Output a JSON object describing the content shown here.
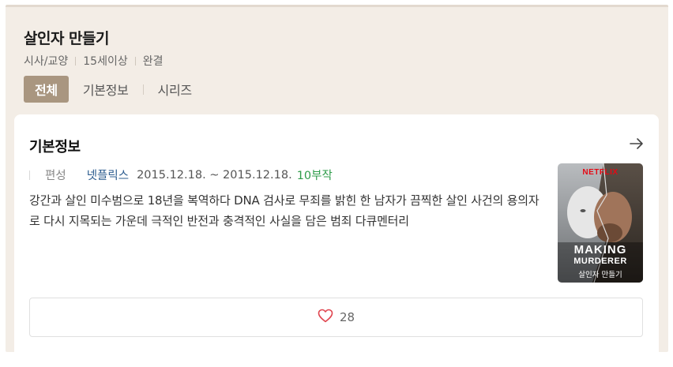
{
  "program": {
    "title": "살인자 만들기",
    "meta": [
      "시사/교양",
      "15세이상",
      "완결"
    ]
  },
  "tabs": [
    "전체",
    "기본정보",
    "시리즈"
  ],
  "info_card": {
    "title": "기본정보",
    "broadcast_label": "편성",
    "channel": "넷플릭스",
    "dates": "2015.12.18. ~ 2015.12.18.",
    "episodes": "10부작",
    "description": "강간과 살인 미수범으로 18년을 복역하다 DNA 검사로 무죄를 밝힌 한 남자가 끔찍한 살인 사건의 용의자로 다시 지목되는 가운데 극적인 반전과 충격적인 사실을 담은 범죄 다큐멘터리",
    "poster": {
      "brand": "NETFLIX",
      "line1": "MAKING",
      "line2": "MURDERER",
      "korean": "살인자 만들기"
    },
    "likes": "28"
  },
  "colors": {
    "page_bg": "#f3ede6",
    "active_tab": "#a99680",
    "channel": "#2c5c8f",
    "episodes": "#2e9c4a",
    "heart": "#e0454f"
  },
  "icons": {
    "arrow": "arrow-right-icon",
    "heart": "heart-outline-icon"
  }
}
